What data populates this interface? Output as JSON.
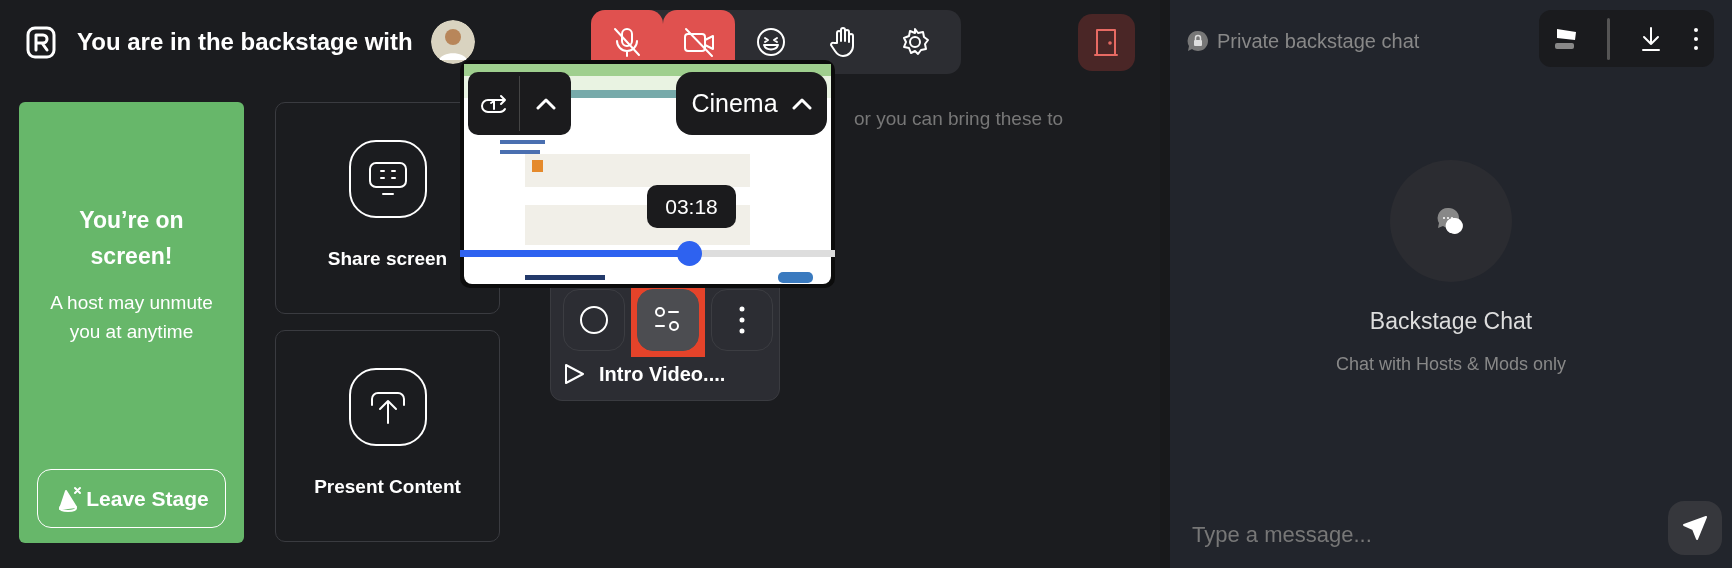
{
  "header": {
    "title": "You are in the backstage with"
  },
  "toolbar": [
    {
      "kind": "mic",
      "muted": true
    },
    {
      "kind": "camera",
      "muted": true
    },
    {
      "kind": "reaction",
      "muted": false
    },
    {
      "kind": "hand",
      "muted": false
    },
    {
      "kind": "settings",
      "muted": false
    }
  ],
  "stage_card": {
    "title": "You’re on screen!",
    "subtitle": "A host may unmute you at anytime",
    "button": "Leave Stage"
  },
  "actions": [
    {
      "kind": "share",
      "label": "Share screen"
    },
    {
      "kind": "present",
      "label": "Present Content"
    }
  ],
  "hint": "or you can bring these to",
  "media": {
    "title": "Intro Video....",
    "buttons": [
      {
        "kind": "record",
        "highlighted": false
      },
      {
        "kind": "adjust",
        "highlighted": true
      },
      {
        "kind": "more",
        "highlighted": false
      }
    ]
  },
  "preview": {
    "kind": "picture",
    "mode": "Cinema",
    "time": "03:18",
    "level": 0.62
  },
  "chat": {
    "header": "Private backstage chat",
    "title": "Backstage Chat",
    "subtitle": "Chat with Hosts & Mods only",
    "placeholder": "Type a message..."
  }
}
